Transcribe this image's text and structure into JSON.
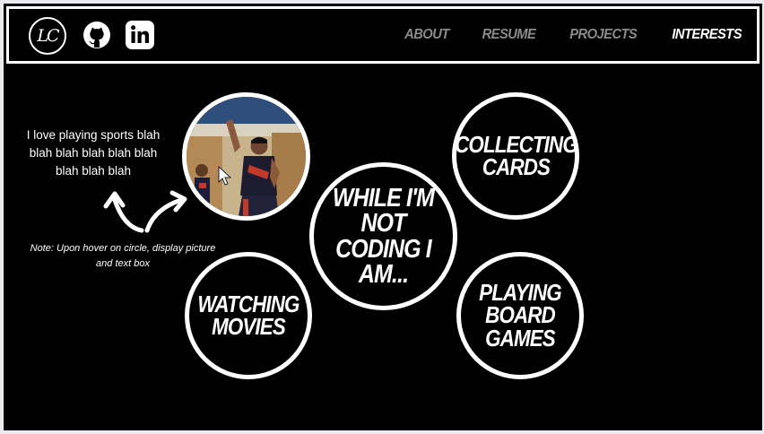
{
  "nav": {
    "logo_text": "LC",
    "icons": [
      "github-icon",
      "linkedin-icon"
    ],
    "links": [
      {
        "label": "ABOUT",
        "active": false
      },
      {
        "label": "RESUME",
        "active": false
      },
      {
        "label": "PROJECTS",
        "active": false
      },
      {
        "label": "INTERESTS",
        "active": true
      }
    ]
  },
  "bio": "I love playing sports blah blah blah blah blah blah blah blah blah",
  "note": "Note: Upon hover on circle, display picture and text box",
  "circles": {
    "center": "WHILE I'M NOT CODING I AM...",
    "cards": "COLLECTING CARDS",
    "movies": "WATCHING MOVIES",
    "board": "PLAYING BOARD GAMES"
  },
  "colors": {
    "background": "#000000",
    "foreground": "#ffffff",
    "nav_inactive": "#8a8a8a"
  }
}
